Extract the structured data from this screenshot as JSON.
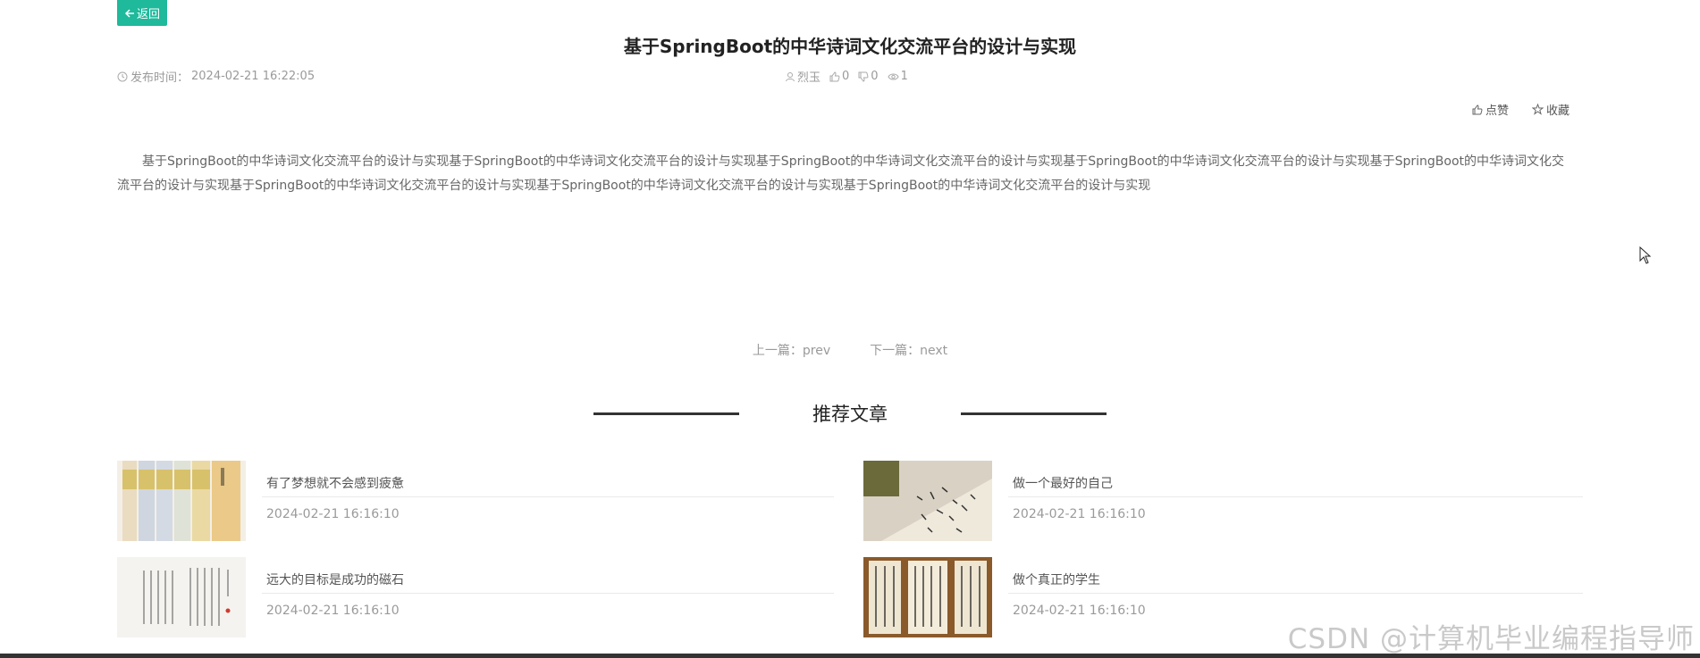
{
  "header": {
    "back_label": "返回",
    "title": "基于SpringBoot的中华诗词文化交流平台的设计与实现"
  },
  "meta": {
    "publish_label": "发布时间：",
    "publish_time": "2024-02-21 16:22:05",
    "author": "烈玉",
    "likes": "0",
    "dislikes": "0",
    "views": "1"
  },
  "actions": {
    "like_label": "点赞",
    "favorite_label": "收藏"
  },
  "content": {
    "body": "基于SpringBoot的中华诗词文化交流平台的设计与实现基于SpringBoot的中华诗词文化交流平台的设计与实现基于SpringBoot的中华诗词文化交流平台的设计与实现基于SpringBoot的中华诗词文化交流平台的设计与实现基于SpringBoot的中华诗词文化交流平台的设计与实现基于SpringBoot的中华诗词文化交流平台的设计与实现基于SpringBoot的中华诗词文化交流平台的设计与实现基于SpringBoot的中华诗词文化交流平台的设计与实现"
  },
  "pager": {
    "prev_label": "上一篇：",
    "prev_value": "prev",
    "next_label": "下一篇：",
    "next_value": "next"
  },
  "recommend": {
    "heading": "推荐文章",
    "items": [
      {
        "title": "有了梦想就不会感到疲惫",
        "date": "2024-02-21 16:16:10"
      },
      {
        "title": "做一个最好的自己",
        "date": "2024-02-21 16:16:10"
      },
      {
        "title": "远大的目标是成功的磁石",
        "date": "2024-02-21 16:16:10"
      },
      {
        "title": "做个真正的学生",
        "date": "2024-02-21 16:16:10"
      }
    ]
  },
  "watermark": "CSDN @计算机毕业编程指导师",
  "colors": {
    "accent": "#1fb99b",
    "text_dark": "#222222",
    "text_muted": "#9a9a9a"
  }
}
